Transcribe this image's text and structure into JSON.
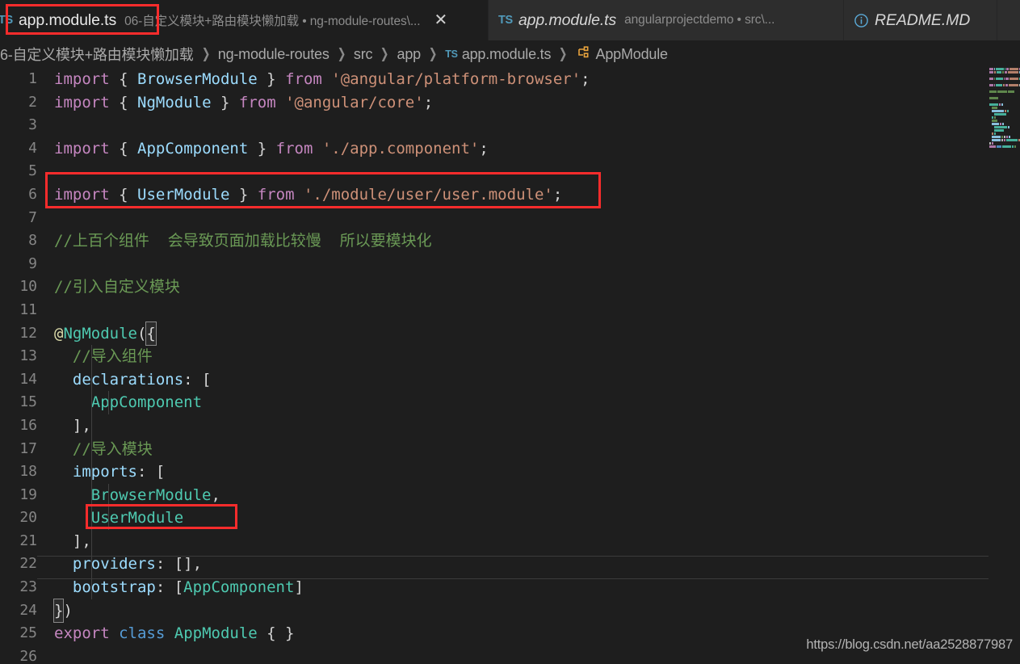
{
  "window": {
    "theme_bg": "#1e1e1e",
    "tabbar_bg": "#252526",
    "accent_red": "#f92c2c"
  },
  "tabs": [
    {
      "icon": "typescript-file-icon",
      "label": "app.module.ts",
      "description": "06-自定义模块+路由模块懒加载 • ng-module-routes\\...",
      "close_label": "✕",
      "active": true
    },
    {
      "icon": "typescript-file-icon",
      "label": "app.module.ts",
      "description": "angularprojectdemo • src\\...",
      "close_label": "",
      "active": false
    },
    {
      "icon": "info-circle-icon",
      "label": "README.MD",
      "description": "",
      "close_label": "",
      "active": false
    }
  ],
  "breadcrumb": {
    "items": [
      {
        "label": "6-自定义模块+路由模块懒加载",
        "icon": ""
      },
      {
        "label": "ng-module-routes",
        "icon": ""
      },
      {
        "label": "src",
        "icon": ""
      },
      {
        "label": "app",
        "icon": ""
      },
      {
        "label": "app.module.ts",
        "icon": "typescript-file-icon"
      },
      {
        "label": "AppModule",
        "icon": "module-symbol-icon"
      }
    ],
    "separator": "❯"
  },
  "editor": {
    "language": "typescript",
    "first_line": 1,
    "last_line": 26,
    "current_line": 22,
    "lines": [
      {
        "n": "1",
        "text": "import { BrowserModule } from '@angular/platform-browser';"
      },
      {
        "n": "2",
        "text": "import { NgModule } from '@angular/core';"
      },
      {
        "n": "3",
        "text": ""
      },
      {
        "n": "4",
        "text": "import { AppComponent } from './app.component';"
      },
      {
        "n": "5",
        "text": ""
      },
      {
        "n": "6",
        "text": "import { UserModule } from './module/user/user.module';"
      },
      {
        "n": "7",
        "text": ""
      },
      {
        "n": "8",
        "text": "//上百个组件  会导致页面加载比较慢  所以要模块化"
      },
      {
        "n": "9",
        "text": ""
      },
      {
        "n": "10",
        "text": "//引入自定义模块"
      },
      {
        "n": "11",
        "text": ""
      },
      {
        "n": "12",
        "text": "@NgModule({"
      },
      {
        "n": "13",
        "text": "  //导入组件"
      },
      {
        "n": "14",
        "text": "  declarations: ["
      },
      {
        "n": "15",
        "text": "    AppComponent"
      },
      {
        "n": "16",
        "text": "  ],"
      },
      {
        "n": "17",
        "text": "  //导入模块"
      },
      {
        "n": "18",
        "text": "  imports: ["
      },
      {
        "n": "19",
        "text": "    BrowserModule,"
      },
      {
        "n": "20",
        "text": "    UserModule"
      },
      {
        "n": "21",
        "text": "  ],"
      },
      {
        "n": "22",
        "text": "  providers: [],"
      },
      {
        "n": "23",
        "text": "  bootstrap: [AppComponent]"
      },
      {
        "n": "24",
        "text": "})"
      },
      {
        "n": "25",
        "text": "export class AppModule { }"
      },
      {
        "n": "26",
        "text": ""
      }
    ]
  },
  "annotations": [
    {
      "name": "tab-filename-highlight",
      "target": "app.module.ts tab label"
    },
    {
      "name": "line-6-highlight",
      "target": "import { UserModule } from './module/user/user.module';"
    },
    {
      "name": "line-20-highlight",
      "target": "UserModule"
    }
  ],
  "watermark": {
    "text": "https://blog.csdn.net/aa2528877987"
  },
  "syntax_colors": {
    "keyword": "#c586c0",
    "keyword_blue": "#569cd6",
    "class": "#4ec9b0",
    "string": "#ce9178",
    "comment": "#6a9955",
    "property": "#9cdcfe",
    "punctuation": "#d4d4d4",
    "line_number": "#858585"
  }
}
